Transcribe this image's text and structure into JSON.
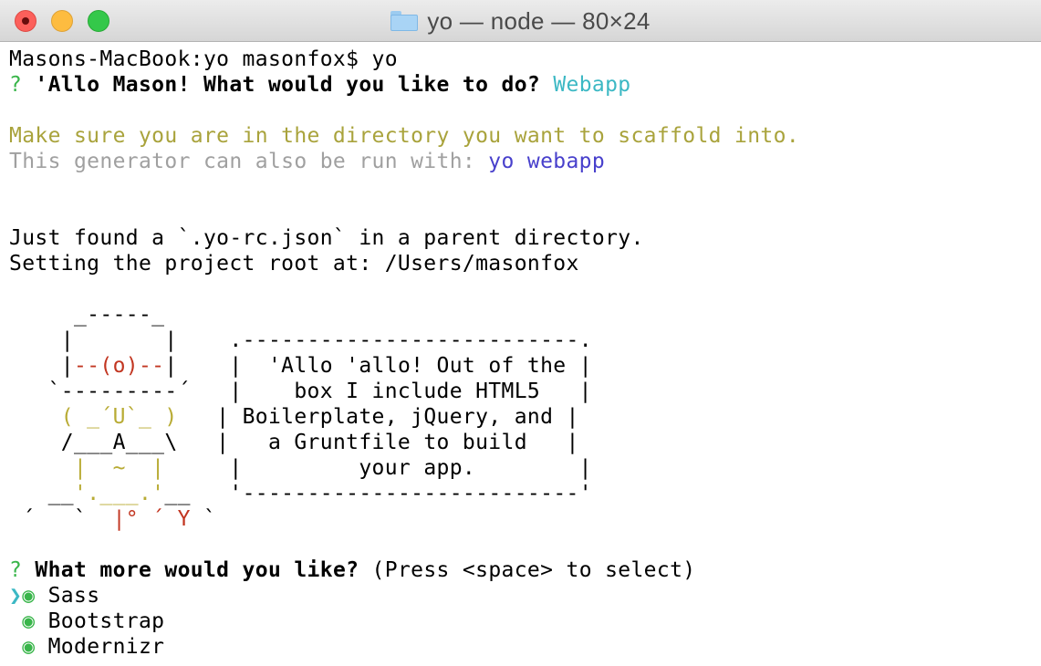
{
  "window": {
    "title": "yo — node — 80×24"
  },
  "terminal": {
    "prompt_line": "Masons-MacBook:yo masonfox$ yo",
    "q1": {
      "mark": "?",
      "question": "'Allo Mason! What would you like to do?",
      "answer": "Webapp"
    },
    "info1": "Make sure you are in the directory you want to scaffold into.",
    "info2_prefix": "This generator can also be run with: ",
    "info2_cmd": "yo webapp",
    "found_line": "Just found a `.yo-rc.json` in a parent directory.",
    "root_line": "Setting the project root at: /Users/masonfox",
    "art": {
      "l1": "     _-----_",
      "l2a": "    |       |",
      "l2b": "    .--------------------------.",
      "l3a": "    |",
      "l3b": "--(o)--",
      "l3c": "|",
      "l3d": "    |  'Allo 'allo! Out of the |",
      "l4a": "   `---------´",
      "l4b": "   |    box I include HTML5   |",
      "l5a": "    ( _´U`_ )",
      "l5b": "   | Boilerplate, jQuery, and |",
      "l6a": "    /___A___\\",
      "l6b": "   |   a Gruntfile to build   |",
      "l7a": "     |  ~  |",
      "l7b": "     |         your app.        |",
      "l8a": "   __",
      "l8b": "'.___.'",
      "l8c": "__",
      "l8d": "   '--------------------------'",
      "l9a": " ´   `  ",
      "l9b": "|° ´ Y",
      "l9c": " `"
    },
    "q2": {
      "mark": "?",
      "question": "What more would you like?",
      "hint": "(Press <space> to select)"
    },
    "pointer": "❯",
    "bullet": "◉",
    "options": [
      "Sass",
      "Bootstrap",
      "Modernizr"
    ]
  }
}
